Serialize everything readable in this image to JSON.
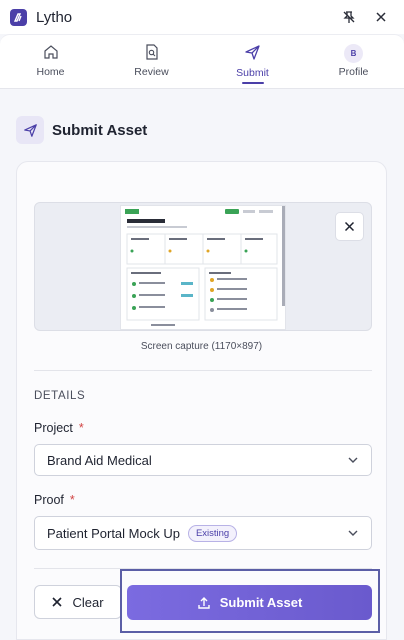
{
  "window": {
    "title": "Lytho"
  },
  "nav": {
    "tabs": [
      {
        "label": "Home",
        "icon": "home-icon"
      },
      {
        "label": "Review",
        "icon": "review-icon"
      },
      {
        "label": "Submit",
        "icon": "send-icon",
        "active": true
      },
      {
        "label": "Profile",
        "icon": "avatar",
        "initial": "B"
      }
    ]
  },
  "pane": {
    "title": "Submit Asset"
  },
  "preview": {
    "caption": "Screen capture (1170×897)"
  },
  "details": {
    "section_title": "DETAILS",
    "project": {
      "label": "Project",
      "required_mark": "*",
      "value": "Brand Aid Medical"
    },
    "proof": {
      "label": "Proof",
      "required_mark": "*",
      "value": "Patient Portal Mock Up",
      "badge": "Existing"
    }
  },
  "actions": {
    "clear_label": "Clear",
    "submit_label": "Submit Asset"
  },
  "colors": {
    "accent": "#4b3fa8",
    "submit": "#6f60d8",
    "required": "#d14343"
  }
}
